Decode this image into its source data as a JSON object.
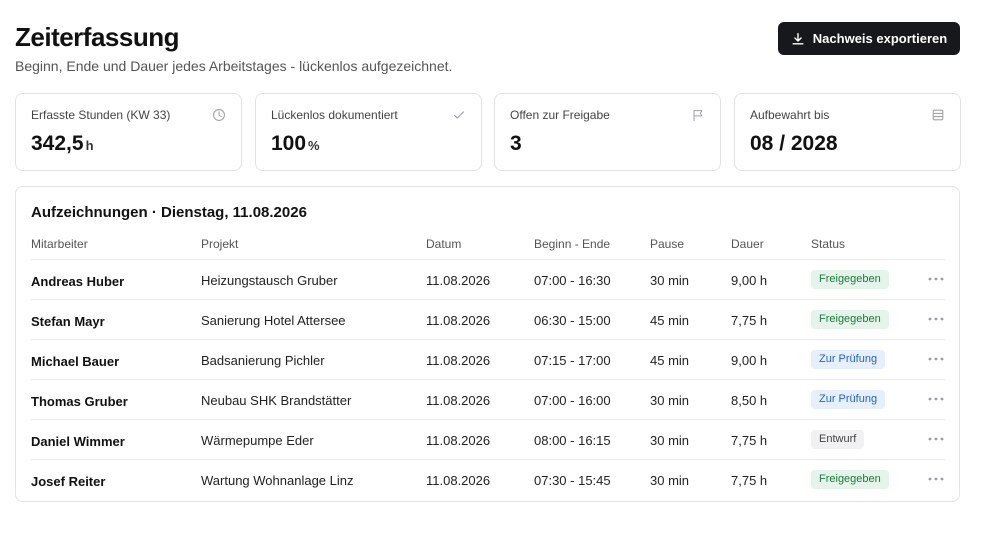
{
  "header": {
    "title": "Zeiterfassung",
    "subtitle": "Beginn, Ende und Dauer jedes Arbeitstages - lückenlos aufgezeichnet.",
    "export_label": "Nachweis exportieren"
  },
  "stats": [
    {
      "label": "Erfasste Stunden (KW 33)",
      "value": "342,5",
      "unit": "h",
      "icon": "clock-icon"
    },
    {
      "label": "Lückenlos dokumentiert",
      "value": "100",
      "unit": "%",
      "icon": "check-icon"
    },
    {
      "label": "Offen zur Freigabe",
      "value": "3",
      "unit": "",
      "icon": "flag-icon"
    },
    {
      "label": "Aufbewahrt bis",
      "value": "08 / 2028",
      "unit": "",
      "icon": "archive-icon"
    }
  ],
  "table": {
    "title": "Aufzeichnungen · Dienstag, 11.08.2026",
    "columns": [
      "Mitarbeiter",
      "Projekt",
      "Datum",
      "Beginn - Ende",
      "Pause",
      "Dauer",
      "Status"
    ],
    "rows": [
      {
        "name": "Andreas Huber",
        "project": "Heizungstausch Gruber",
        "date": "11.08.2026",
        "time": "07:00 - 16:30",
        "pause": "30 min",
        "duration": "9,00 h",
        "status": "Freigegeben",
        "status_type": "ok"
      },
      {
        "name": "Stefan Mayr",
        "project": "Sanierung Hotel Attersee",
        "date": "11.08.2026",
        "time": "06:30 - 15:00",
        "pause": "45 min",
        "duration": "7,75 h",
        "status": "Freigegeben",
        "status_type": "ok"
      },
      {
        "name": "Michael Bauer",
        "project": "Badsanierung Pichler",
        "date": "11.08.2026",
        "time": "07:15 - 17:00",
        "pause": "45 min",
        "duration": "9,00 h",
        "status": "Zur Prüfung",
        "status_type": "review"
      },
      {
        "name": "Thomas Gruber",
        "project": "Neubau SHK Brandstätter",
        "date": "11.08.2026",
        "time": "07:00 - 16:00",
        "pause": "30 min",
        "duration": "8,50 h",
        "status": "Zur Prüfung",
        "status_type": "review"
      },
      {
        "name": "Daniel Wimmer",
        "project": "Wärmepumpe Eder",
        "date": "11.08.2026",
        "time": "08:00 - 16:15",
        "pause": "30 min",
        "duration": "7,75 h",
        "status": "Entwurf",
        "status_type": "draft"
      },
      {
        "name": "Josef Reiter",
        "project": "Wartung Wohnanlage Linz",
        "date": "11.08.2026",
        "time": "07:30 - 15:45",
        "pause": "30 min",
        "duration": "7,75 h",
        "status": "Freigegeben",
        "status_type": "ok"
      }
    ]
  },
  "colors": {
    "accent_button": "#17181c",
    "approved_bg": "#e5f4ea",
    "approved_text": "#1e7a3c",
    "review_bg": "#e6effc",
    "review_text": "#2563c9",
    "draft_bg": "#f1f1f3"
  }
}
